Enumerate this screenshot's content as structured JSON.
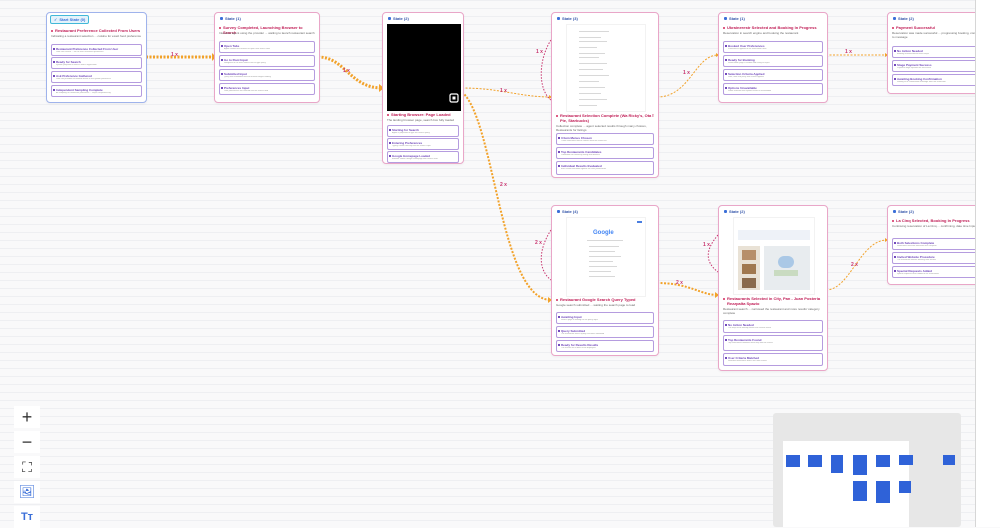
{
  "nodes": {
    "start": {
      "badge": "Start State (0)",
      "title": "Restaurant Preference Collected From Users",
      "desc": "Indicating a restaurant selection ... cuisine for exact food preference",
      "actions": [
        {
          "name": "Restaurant Preference Collected From User",
          "detail": "User has chosen ... for the user restaurant preference"
        },
        {
          "name": "Ready for Search",
          "detail": "System prepared to launch search application"
        },
        {
          "name": "Ask Preference Gathered",
          "detail": "User has provided all needed details in the system preference"
        },
        {
          "name": "Independent Sampling Complete",
          "detail": "All sampling for restaurant preference ... steps completed fully"
        }
      ]
    },
    "s1": {
      "header": "State (1)",
      "title": "Survey Completed, Launching Browser to Search",
      "desc": "Interview agent using the provider ... waiting to launch restaurant search",
      "actions": [
        {
          "name": "Open Tabs",
          "detail": "Agent invokes the browser to open new search tabs"
        },
        {
          "name": "Go to Root Input",
          "detail": "Navigates to the main search box to type query"
        },
        {
          "name": "Submitted Input",
          "detail": "Query was submitted and the browser began loading"
        },
        {
          "name": "Preferences Input",
          "detail": "User preferences are entered into the search field"
        }
      ]
    },
    "s2": {
      "header": "State (2)",
      "title": "Starting Browser: Page Loaded",
      "desc": "The landing browser page, search box fully loaded and ready",
      "actions": [
        {
          "name": "Starting for Search",
          "detail": "Agent is prepared to type the search query"
        },
        {
          "name": "Entering Preferences",
          "detail": "Typing cuisine and city into the search input"
        },
        {
          "name": "Google Homepage Loaded",
          "detail": "Browser shows Google homepage with search field"
        }
      ]
    },
    "s3": {
      "header": "State (3)",
      "title": "Restaurant Selection Complete (Wa Ricky's, Ota Ï Pie, Starbucks)",
      "desc": "Collection complete ... agent selected results through many choices, Restaurants for listings",
      "actions": [
        {
          "name": "3 Item Menus Chosen",
          "detail": "Three restaurant menus chosen from the results list"
        },
        {
          "name": "Top Restaurants Candidates",
          "detail": "Candidate list ranked by rating and distance"
        },
        {
          "name": "Individual Results Evaluated",
          "detail": "Each result evaluated against the user preferences"
        }
      ]
    },
    "s4": {
      "header": "State (1)",
      "title": "Ukrainerestr Selected and Booking In Progress",
      "desc": "Reservation in search engine and booking the restaurant",
      "actions": [
        {
          "name": "Booked User Preferences",
          "detail": "Preferences applied to the reservation form"
        },
        {
          "name": "Ready for Booking",
          "detail": "Reservation page is loaded and ready for input"
        },
        {
          "name": "Selection Criteria Applied",
          "detail": "Date, time and party size criteria applied"
        },
        {
          "name": "Options Unavailable",
          "detail": "Some selected time options show as unavailable"
        }
      ]
    },
    "s5": {
      "header": "State (2)",
      "title": "Payment Successful",
      "desc": "Reservation was made successful ... progressing booking, confirmed to message",
      "actions": [
        {
          "name": "No Action Needed",
          "detail": "Booking finished without extra steps"
        },
        {
          "name": "Stage Payment Success",
          "detail": "Payment stage reported as successful"
        },
        {
          "name": "Awaiting Booking Confirmation",
          "detail": "Waiting for a confirmation message from the restaurant"
        }
      ]
    },
    "s6": {
      "header": "State (4)",
      "title": "Restaurant Google Search Query Typed",
      "desc": "Google search submitted ... waiting the search page to load",
      "actions": [
        {
          "name": "Awaiting Input",
          "detail": "Search page is waiting for the query input"
        },
        {
          "name": "Query Submitted",
          "detail": "The restaurant search query has been submitted"
        },
        {
          "name": "Ready for Results Results",
          "detail": "The results list is about to be displayed"
        }
      ]
    },
    "s7": {
      "header": "State (2)",
      "title": "Restaurants Selected in City, Pan - Juan Posteria Rezzpalta Spazio",
      "desc": "Restaurant search ... narrowed the restaurant and more results' category complete",
      "actions": [
        {
          "name": "No Action Needed",
          "detail": "The map result already shows the chosen venue"
        },
        {
          "name": "Top Restaurants Found",
          "detail": "Top restaurants identified from map and list results"
        },
        {
          "name": "User Criteria Matched",
          "detail": "Selected restaurants match the user criteria"
        }
      ]
    },
    "s8": {
      "header": "State (2)",
      "title": "La Cinq Selected, Booking In Progress",
      "desc": "Continuing reservation of La Cinq ... confirming, date time Input",
      "actions": [
        {
          "name": "Both Selections Complete",
          "detail": "Restaurant and time selections are complete"
        },
        {
          "name": "Invited Website Procedure",
          "detail": "The restaurant website booking flow started"
        },
        {
          "name": "Special Requests Added",
          "detail": "Special requests were added to the reservation"
        }
      ]
    }
  },
  "edges": {
    "e1": "1 x",
    "e2": "1 x",
    "e3": "1 x",
    "e4": "2 x",
    "e5": "1 x",
    "e6": "1 x",
    "e7": "1 x",
    "e8": "2 x",
    "e9": "2 x",
    "e10": "1 x",
    "e11": "2 x"
  },
  "shots": {
    "google_logo": "Google"
  },
  "toolbar": {
    "zoom_in": "+",
    "zoom_out": "−",
    "fit": "⛶",
    "image": "🖼",
    "text": "Tт"
  },
  "colors": {
    "edge": "#f2a22a",
    "edge_self": "#c8346e",
    "node_border": "#e9a6c8",
    "minimap_node": "#2f62d8"
  }
}
